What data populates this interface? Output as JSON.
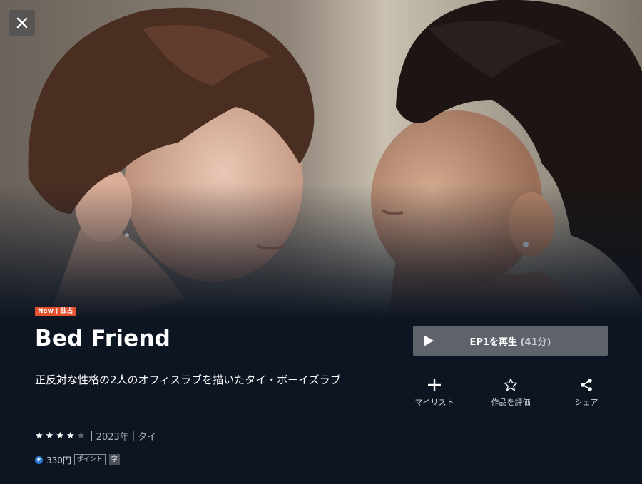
{
  "hero": {
    "badge": "New | 独占"
  },
  "title": "Bed Friend",
  "description": "正反対な性格の2人のオフィスラブを描いたタイ・ボーイズラブ",
  "rating": {
    "value": 4,
    "max": 5
  },
  "meta": {
    "year": "2023年",
    "country": "タイ",
    "separator": "|"
  },
  "price": {
    "icon": "P",
    "amount": "330円",
    "point_tag": "ポイント",
    "subtitle_tag": "字"
  },
  "play_button": {
    "label": "EP1を再生",
    "duration": "(41分)"
  },
  "actions": [
    {
      "label": "マイリスト",
      "icon": "plus-icon"
    },
    {
      "label": "作品を評価",
      "icon": "star-outline-icon"
    },
    {
      "label": "シェア",
      "icon": "share-icon"
    }
  ],
  "colors": {
    "background": "#0d1522",
    "badge": "#e5512c",
    "play_button": "#5d626b",
    "point_icon": "#2a7ad6"
  }
}
